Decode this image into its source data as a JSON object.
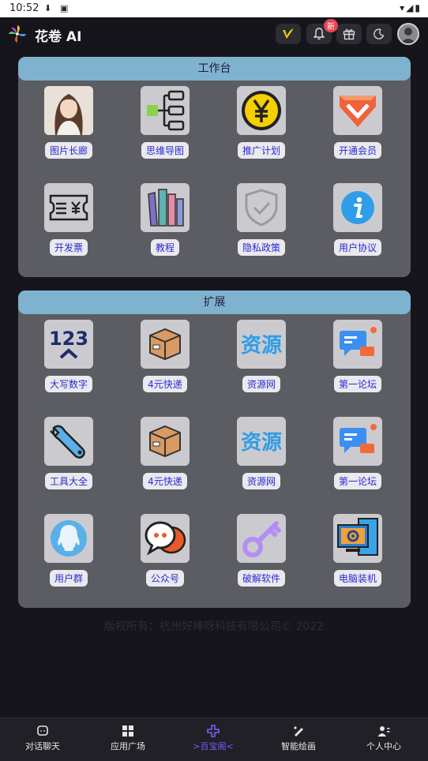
{
  "status_bar": {
    "time": "10:52"
  },
  "header": {
    "title": "花卷 AI",
    "badge": "新"
  },
  "workbench": {
    "title": "工作台",
    "items": [
      {
        "label": "图片长廊",
        "icon": "portrait-photo-icon"
      },
      {
        "label": "思维导图",
        "icon": "mind-map-icon"
      },
      {
        "label": "推广计划",
        "icon": "yen-coin-icon"
      },
      {
        "label": "开通会员",
        "icon": "vip-chevron-icon"
      },
      {
        "label": "开发票",
        "icon": "invoice-ticket-icon"
      },
      {
        "label": "教程",
        "icon": "books-icon"
      },
      {
        "label": "隐私政策",
        "icon": "shield-check-icon"
      },
      {
        "label": "用户协议",
        "icon": "info-icon"
      }
    ]
  },
  "extension": {
    "title": "扩展",
    "items": [
      {
        "label": "大写数字",
        "icon": "numbers-icon"
      },
      {
        "label": "4元快递",
        "icon": "package-box-icon"
      },
      {
        "label": "资源网",
        "icon": "resource-text-icon"
      },
      {
        "label": "第一论坛",
        "icon": "chat-bubbles-icon"
      },
      {
        "label": "工具大全",
        "icon": "wrench-icon"
      },
      {
        "label": "4元快递",
        "icon": "package-box-icon"
      },
      {
        "label": "资源网",
        "icon": "resource-text-icon"
      },
      {
        "label": "第一论坛",
        "icon": "chat-bubbles-icon"
      },
      {
        "label": "用户群",
        "icon": "qq-penguin-icon"
      },
      {
        "label": "公众号",
        "icon": "speech-bubbles-icon"
      },
      {
        "label": "破解软件",
        "icon": "key-icon"
      },
      {
        "label": "电脑装机",
        "icon": "computer-gear-icon"
      }
    ]
  },
  "footer": {
    "text": "版权所有：杭州好棒呀科技有限公司© 2022"
  },
  "bottom_nav": [
    {
      "label": "对话聊天"
    },
    {
      "label": "应用广场"
    },
    {
      "label": ">百宝阁<"
    },
    {
      "label": "智能绘画"
    },
    {
      "label": "个人中心"
    }
  ],
  "colors": {
    "accent": "#7a5cff",
    "panel": "#5c5c63",
    "panel_header": "#7fb2cf",
    "label_text": "#2a2bd0"
  }
}
